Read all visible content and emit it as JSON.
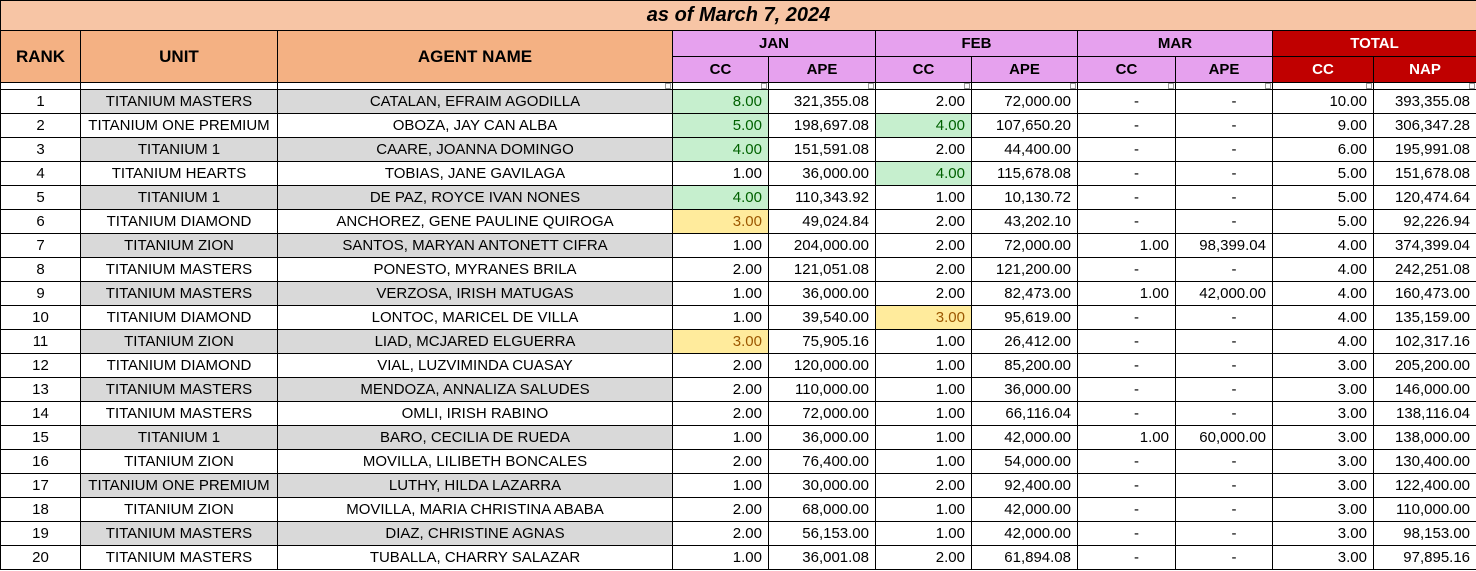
{
  "title": "as of March 7, 2024",
  "headers": {
    "rank": "RANK",
    "unit": "UNIT",
    "agent": "AGENT NAME",
    "months": [
      "JAN",
      "FEB",
      "MAR"
    ],
    "total": "TOTAL",
    "cc": "CC",
    "ape": "APE",
    "nap": "NAP"
  },
  "colors": {
    "title_bg": "#f7c5a5",
    "left_header_bg": "#f4b183",
    "month_header_bg": "#e6a1ee",
    "total_header_bg": "#c00000",
    "row_shade": "#d9d9d9",
    "green_highlight": "#c6efce",
    "yellow_highlight": "#ffeb9c"
  },
  "rows": [
    {
      "rank": "1",
      "unit": "TITANIUM MASTERS",
      "agent": "CATALAN, EFRAIM AGODILLA",
      "jan_cc": "8.00",
      "jan_ape": "321,355.08",
      "feb_cc": "2.00",
      "feb_ape": "72,000.00",
      "mar_cc": "-",
      "mar_ape": "-",
      "tot_cc": "10.00",
      "nap": "393,355.08",
      "hl": {
        "jan_cc": "g"
      }
    },
    {
      "rank": "2",
      "unit": "TITANIUM ONE PREMIUM",
      "agent": "OBOZA, JAY CAN ALBA",
      "jan_cc": "5.00",
      "jan_ape": "198,697.08",
      "feb_cc": "4.00",
      "feb_ape": "107,650.20",
      "mar_cc": "-",
      "mar_ape": "-",
      "tot_cc": "9.00",
      "nap": "306,347.28",
      "hl": {
        "jan_cc": "g",
        "feb_cc": "g"
      }
    },
    {
      "rank": "3",
      "unit": "TITANIUM 1",
      "agent": "CAARE, JOANNA DOMINGO",
      "jan_cc": "4.00",
      "jan_ape": "151,591.08",
      "feb_cc": "2.00",
      "feb_ape": "44,400.00",
      "mar_cc": "-",
      "mar_ape": "-",
      "tot_cc": "6.00",
      "nap": "195,991.08",
      "hl": {
        "jan_cc": "g"
      }
    },
    {
      "rank": "4",
      "unit": "TITANIUM HEARTS",
      "agent": "TOBIAS, JANE GAVILAGA",
      "jan_cc": "1.00",
      "jan_ape": "36,000.00",
      "feb_cc": "4.00",
      "feb_ape": "115,678.08",
      "mar_cc": "-",
      "mar_ape": "-",
      "tot_cc": "5.00",
      "nap": "151,678.08",
      "hl": {
        "feb_cc": "g"
      }
    },
    {
      "rank": "5",
      "unit": "TITANIUM 1",
      "agent": "DE PAZ, ROYCE IVAN NONES",
      "jan_cc": "4.00",
      "jan_ape": "110,343.92",
      "feb_cc": "1.00",
      "feb_ape": "10,130.72",
      "mar_cc": "-",
      "mar_ape": "-",
      "tot_cc": "5.00",
      "nap": "120,474.64",
      "hl": {
        "jan_cc": "g"
      }
    },
    {
      "rank": "6",
      "unit": "TITANIUM DIAMOND",
      "agent": "ANCHOREZ, GENE PAULINE QUIROGA",
      "jan_cc": "3.00",
      "jan_ape": "49,024.84",
      "feb_cc": "2.00",
      "feb_ape": "43,202.10",
      "mar_cc": "-",
      "mar_ape": "-",
      "tot_cc": "5.00",
      "nap": "92,226.94",
      "hl": {
        "jan_cc": "y"
      }
    },
    {
      "rank": "7",
      "unit": "TITANIUM ZION",
      "agent": "SANTOS, MARYAN ANTONETT CIFRA",
      "jan_cc": "1.00",
      "jan_ape": "204,000.00",
      "feb_cc": "2.00",
      "feb_ape": "72,000.00",
      "mar_cc": "1.00",
      "mar_ape": "98,399.04",
      "tot_cc": "4.00",
      "nap": "374,399.04",
      "hl": {}
    },
    {
      "rank": "8",
      "unit": "TITANIUM MASTERS",
      "agent": "PONESTO, MYRANES BRILA",
      "jan_cc": "2.00",
      "jan_ape": "121,051.08",
      "feb_cc": "2.00",
      "feb_ape": "121,200.00",
      "mar_cc": "-",
      "mar_ape": "-",
      "tot_cc": "4.00",
      "nap": "242,251.08",
      "hl": {}
    },
    {
      "rank": "9",
      "unit": "TITANIUM MASTERS",
      "agent": "VERZOSA, IRISH MATUGAS",
      "jan_cc": "1.00",
      "jan_ape": "36,000.00",
      "feb_cc": "2.00",
      "feb_ape": "82,473.00",
      "mar_cc": "1.00",
      "mar_ape": "42,000.00",
      "tot_cc": "4.00",
      "nap": "160,473.00",
      "hl": {}
    },
    {
      "rank": "10",
      "unit": "TITANIUM DIAMOND",
      "agent": "LONTOC, MARICEL DE VILLA",
      "jan_cc": "1.00",
      "jan_ape": "39,540.00",
      "feb_cc": "3.00",
      "feb_ape": "95,619.00",
      "mar_cc": "-",
      "mar_ape": "-",
      "tot_cc": "4.00",
      "nap": "135,159.00",
      "hl": {
        "feb_cc": "y"
      }
    },
    {
      "rank": "11",
      "unit": "TITANIUM ZION",
      "agent": "LIAD, MCJARED ELGUERRA",
      "jan_cc": "3.00",
      "jan_ape": "75,905.16",
      "feb_cc": "1.00",
      "feb_ape": "26,412.00",
      "mar_cc": "-",
      "mar_ape": "-",
      "tot_cc": "4.00",
      "nap": "102,317.16",
      "hl": {
        "jan_cc": "y"
      }
    },
    {
      "rank": "12",
      "unit": "TITANIUM DIAMOND",
      "agent": "VIAL, LUZVIMINDA CUASAY",
      "jan_cc": "2.00",
      "jan_ape": "120,000.00",
      "feb_cc": "1.00",
      "feb_ape": "85,200.00",
      "mar_cc": "-",
      "mar_ape": "-",
      "tot_cc": "3.00",
      "nap": "205,200.00",
      "hl": {}
    },
    {
      "rank": "13",
      "unit": "TITANIUM MASTERS",
      "agent": "MENDOZA, ANNALIZA SALUDES",
      "jan_cc": "2.00",
      "jan_ape": "110,000.00",
      "feb_cc": "1.00",
      "feb_ape": "36,000.00",
      "mar_cc": "-",
      "mar_ape": "-",
      "tot_cc": "3.00",
      "nap": "146,000.00",
      "hl": {}
    },
    {
      "rank": "14",
      "unit": "TITANIUM MASTERS",
      "agent": "OMLI, IRISH RABINO",
      "jan_cc": "2.00",
      "jan_ape": "72,000.00",
      "feb_cc": "1.00",
      "feb_ape": "66,116.04",
      "mar_cc": "-",
      "mar_ape": "-",
      "tot_cc": "3.00",
      "nap": "138,116.04",
      "hl": {}
    },
    {
      "rank": "15",
      "unit": "TITANIUM 1",
      "agent": "BARO, CECILIA DE RUEDA",
      "jan_cc": "1.00",
      "jan_ape": "36,000.00",
      "feb_cc": "1.00",
      "feb_ape": "42,000.00",
      "mar_cc": "1.00",
      "mar_ape": "60,000.00",
      "tot_cc": "3.00",
      "nap": "138,000.00",
      "hl": {}
    },
    {
      "rank": "16",
      "unit": "TITANIUM ZION",
      "agent": "MOVILLA, LILIBETH BONCALES",
      "jan_cc": "2.00",
      "jan_ape": "76,400.00",
      "feb_cc": "1.00",
      "feb_ape": "54,000.00",
      "mar_cc": "-",
      "mar_ape": "-",
      "tot_cc": "3.00",
      "nap": "130,400.00",
      "hl": {}
    },
    {
      "rank": "17",
      "unit": "TITANIUM ONE PREMIUM",
      "agent": "LUTHY, HILDA LAZARRA",
      "jan_cc": "1.00",
      "jan_ape": "30,000.00",
      "feb_cc": "2.00",
      "feb_ape": "92,400.00",
      "mar_cc": "-",
      "mar_ape": "-",
      "tot_cc": "3.00",
      "nap": "122,400.00",
      "hl": {}
    },
    {
      "rank": "18",
      "unit": "TITANIUM ZION",
      "agent": "MOVILLA, MARIA CHRISTINA ABABA",
      "jan_cc": "2.00",
      "jan_ape": "68,000.00",
      "feb_cc": "1.00",
      "feb_ape": "42,000.00",
      "mar_cc": "-",
      "mar_ape": "-",
      "tot_cc": "3.00",
      "nap": "110,000.00",
      "hl": {}
    },
    {
      "rank": "19",
      "unit": "TITANIUM MASTERS",
      "agent": "DIAZ, CHRISTINE AGNAS",
      "jan_cc": "2.00",
      "jan_ape": "56,153.00",
      "feb_cc": "1.00",
      "feb_ape": "42,000.00",
      "mar_cc": "-",
      "mar_ape": "-",
      "tot_cc": "3.00",
      "nap": "98,153.00",
      "hl": {}
    },
    {
      "rank": "20",
      "unit": "TITANIUM MASTERS",
      "agent": "TUBALLA, CHARRY SALAZAR",
      "jan_cc": "1.00",
      "jan_ape": "36,001.08",
      "feb_cc": "2.00",
      "feb_ape": "61,894.08",
      "mar_cc": "-",
      "mar_ape": "-",
      "tot_cc": "3.00",
      "nap": "97,895.16",
      "hl": {}
    }
  ]
}
